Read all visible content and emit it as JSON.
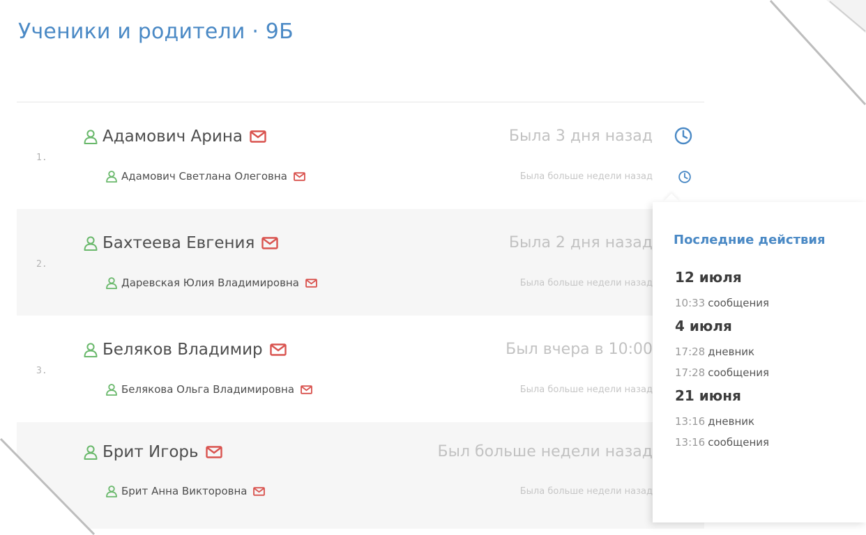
{
  "page": {
    "title": "Ученики и родители · 9Б"
  },
  "colors": {
    "accent": "#4a89c5",
    "person_icon": "#69b86b",
    "mail_icon": "#d9534f",
    "muted": "#c2c2c2"
  },
  "icons": {
    "person": "person-icon",
    "mail": "mail-icon",
    "clock": "clock-icon"
  },
  "students": [
    {
      "number": "1.",
      "name": "Адамович Арина",
      "status": "Была 3 дня назад",
      "parent": {
        "name": "Адамович Светлана Олеговна",
        "status": "Была больше недели назад"
      }
    },
    {
      "number": "2.",
      "name": "Бахтеева Евгения",
      "status": "Была 2 дня назад",
      "parent": {
        "name": "Даревская Юлия Владимировна",
        "status": "Была больше недели назад"
      }
    },
    {
      "number": "3.",
      "name": "Беляков Владимир",
      "status": "Был вчера в 10:00",
      "parent": {
        "name": "Белякова Ольга Владимировна",
        "status": "Была больше недели назад"
      }
    },
    {
      "number": "",
      "name": "Брит Игорь",
      "status": "Был больше недели назад",
      "parent": {
        "name": "Брит Анна Викторовна",
        "status": "Была больше недели назад"
      }
    }
  ],
  "popover": {
    "title": "Последние действия",
    "groups": [
      {
        "date": "12 июля",
        "actions": [
          {
            "time": "10:33",
            "label": "сообщения"
          }
        ]
      },
      {
        "date": "4 июля",
        "actions": [
          {
            "time": "17:28",
            "label": "дневник"
          },
          {
            "time": "17:28",
            "label": "сообщения"
          }
        ]
      },
      {
        "date": "21 июня",
        "actions": [
          {
            "time": "13:16",
            "label": "дневник"
          },
          {
            "time": "13:16",
            "label": "сообщения"
          }
        ]
      }
    ]
  }
}
